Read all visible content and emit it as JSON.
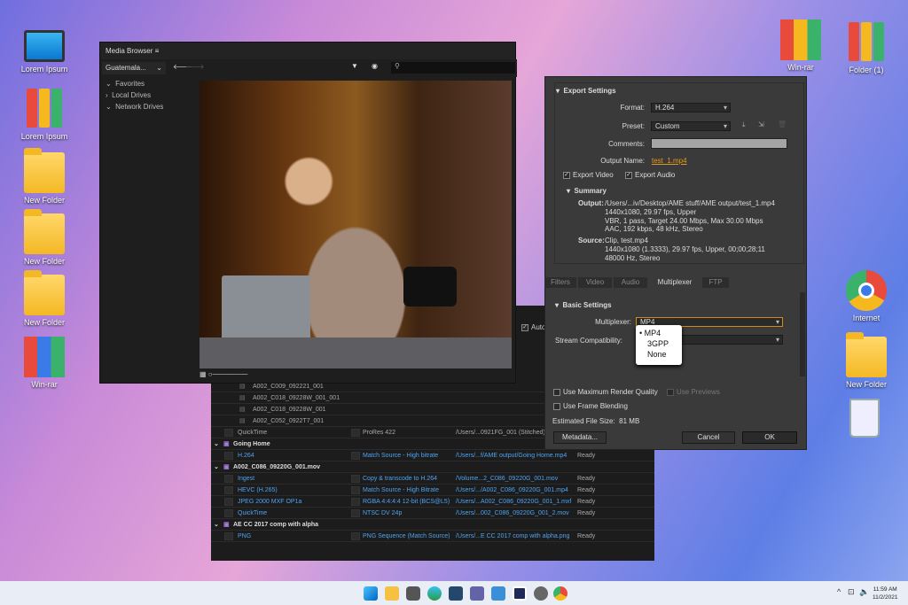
{
  "desktop": {
    "left_icons": [
      "Lorem Ipsum",
      "Lorem Ipsum",
      "New Folder",
      "New Folder",
      "New Folder",
      "Win-rar"
    ],
    "right_icons": [
      "Win-rar",
      "Folder (1)",
      "Internet",
      "New Folder"
    ]
  },
  "media_browser": {
    "title": "Media Browser",
    "location": "Guatemala...",
    "tree": [
      "Favorites",
      "Local Drives",
      "Network Drives"
    ]
  },
  "queue": {
    "auto_label": "Auto",
    "clips": [
      "A002_C009_092221_001",
      "A002_C018_09228W_001_001",
      "A002_C018_09228W_001",
      "A002_C052_0922T7_001"
    ],
    "rows": [
      {
        "type": "item",
        "format": "QuickTime",
        "preset": "ProRes 422",
        "output": "/Users/...0921FG_001 (Stitched)",
        "status": "",
        "dim": true
      },
      {
        "type": "group",
        "name": "Going Home"
      },
      {
        "type": "item",
        "format": "H.264",
        "preset": "Match Source - High bitrate",
        "output": "/Users/...f/AME output/Going Home.mp4",
        "status": "Ready"
      },
      {
        "type": "group",
        "name": "A002_C086_09220G_001.mov"
      },
      {
        "type": "item",
        "format": "Ingest",
        "preset": "Copy & transcode to H.264",
        "output": "/Volume...2_C086_09220G_001.mov",
        "status": "Ready"
      },
      {
        "type": "item",
        "format": "HEVC (H.265)",
        "preset": "Match Source - High Bitrate",
        "output": "/Users/.../A002_C086_09220G_001.mp4",
        "status": "Ready"
      },
      {
        "type": "item",
        "format": "JPEG 2000 MXF OP1a",
        "preset": "RGBA 4:4:4:4 12-bit (BCS@L5)",
        "output": "/Users/...A002_C086_09220G_001_1.mxf",
        "status": "Ready"
      },
      {
        "type": "item",
        "format": "QuickTime",
        "preset": "NTSC DV 24p",
        "output": "/Users/...002_C086_09220G_001_2.mov",
        "status": "Ready"
      },
      {
        "type": "group",
        "name": "AE CC 2017 comp with alpha"
      },
      {
        "type": "item",
        "format": "PNG",
        "preset": "PNG Sequence (Match Source)",
        "output": "/Users/...E CC 2017 comp with alpha.png",
        "status": "Ready"
      }
    ]
  },
  "export": {
    "section": "Export Settings",
    "format_label": "Format:",
    "format": "H.264",
    "preset_label": "Preset:",
    "preset": "Custom",
    "comments_label": "Comments:",
    "output_name_label": "Output Name:",
    "output_name": "test_1.mp4",
    "export_video": "Export Video",
    "export_audio": "Export Audio",
    "summary": "Summary",
    "output_label": "Output:",
    "output_lines": [
      "/Users/...iv/Desktop/AME stuff/AME output/test_1.mp4",
      "1440x1080, 29.97 fps, Upper",
      "VBR, 1 pass, Target 24.00 Mbps, Max 30.00 Mbps",
      "AAC, 192 kbps, 48 kHz, Stereo"
    ],
    "source_label": "Source:",
    "source_lines": [
      "Clip, test.mp4",
      "1440x1080 (1.3333), 29.97 fps, Upper, 00;00;28;11",
      "48000 Hz, Stereo"
    ],
    "tabs": [
      "Filters",
      "Video",
      "Audio",
      "Multiplexer",
      "FTP"
    ],
    "basic": "Basic Settings",
    "mux_label": "Multiplexer:",
    "mux": "MP4",
    "stream_label": "Stream Compatibility:",
    "mux_options": [
      "MP4",
      "3GPP",
      "None"
    ],
    "max_quality": "Use Maximum Render Quality",
    "previews": "Use Previews",
    "frame_blending": "Use Frame Blending",
    "file_size_label": "Estimated File Size:",
    "file_size": "81 MB",
    "metadata": "Metadata...",
    "cancel": "Cancel",
    "ok": "OK"
  },
  "taskbar": {
    "time": "11:59 AM",
    "date": "11/2/2021"
  }
}
